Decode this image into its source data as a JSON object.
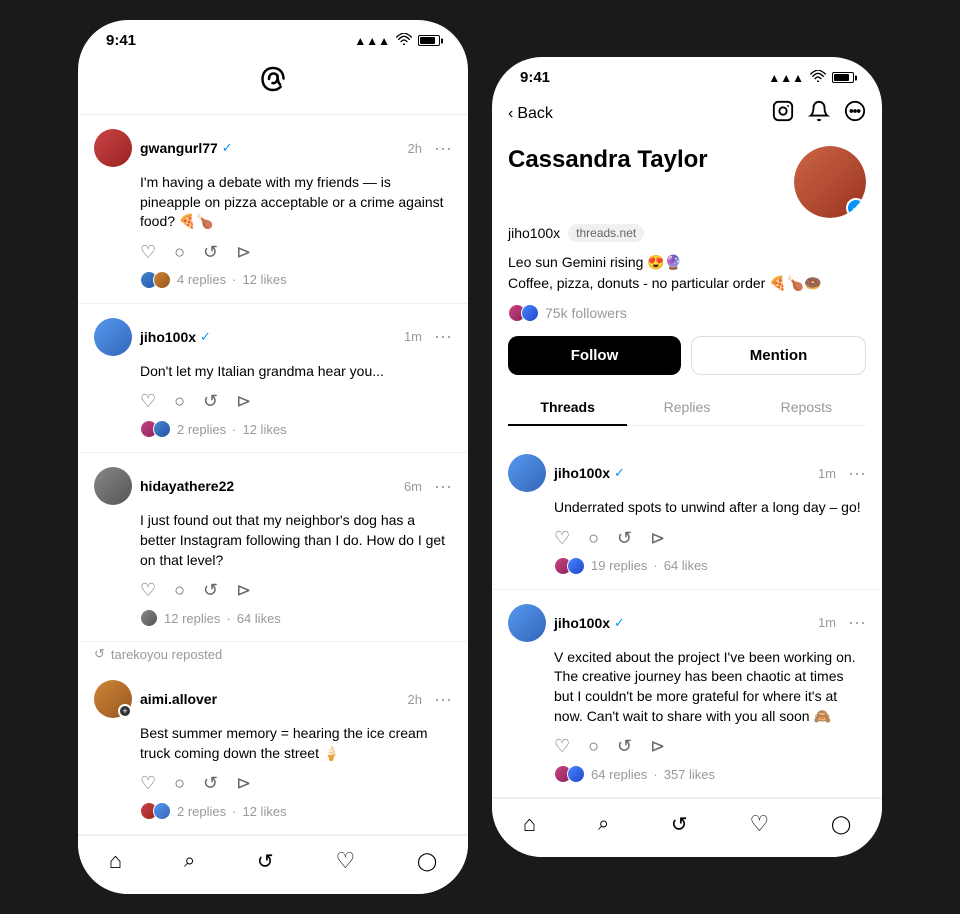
{
  "phone1": {
    "status": {
      "time": "9:41",
      "signal": "▲▲▲",
      "wifi": "wifi",
      "battery": "battery"
    },
    "logo": "⊕",
    "posts": [
      {
        "id": "post1",
        "username": "gwangurl77",
        "verified": true,
        "time": "2h",
        "avatar_color": "av1",
        "body": "I'm having a debate with my friends — is pineapple on pizza acceptable or a crime against food? 🍕🍗",
        "replies": "4 replies",
        "likes": "12 likes"
      },
      {
        "id": "post2",
        "username": "jiho100x",
        "verified": true,
        "time": "1m",
        "avatar_color": "av-jiho",
        "body": "Don't let my Italian grandma hear you...",
        "replies": "2 replies",
        "likes": "12 likes"
      },
      {
        "id": "post3",
        "username": "hidayathere22",
        "verified": false,
        "time": "6m",
        "avatar_color": "av3",
        "body": "I just found out that my neighbor's dog has a better Instagram following than I do. How do I get on that level?",
        "replies": "12 replies",
        "likes": "64 likes"
      }
    ],
    "repost": {
      "label": "tarekoyou reposted",
      "post": {
        "username": "aimi.allover",
        "verified": false,
        "time": "2h",
        "avatar_color": "av4",
        "body": "Best summer memory = hearing the ice cream truck coming down the street 🍦",
        "replies": "2 replies",
        "likes": "12 likes"
      }
    },
    "nav": {
      "home": "⌂",
      "search": "⌕",
      "compose": "↺",
      "heart": "♡",
      "profile": "◯"
    }
  },
  "phone2": {
    "status": {
      "time": "9:41"
    },
    "back_label": "Back",
    "profile": {
      "name": "Cassandra Taylor",
      "handle": "jiho100x",
      "domain": "threads.net",
      "bio_line1": "Leo sun Gemini rising 😍🔮",
      "bio_line2": "Coffee, pizza, donuts - no particular order 🍕🍗🍩",
      "followers": "75k followers",
      "avatar_color": "av-cassandra",
      "follow_btn": "Follow",
      "mention_btn": "Mention"
    },
    "tabs": [
      {
        "label": "Threads",
        "active": true
      },
      {
        "label": "Replies",
        "active": false
      },
      {
        "label": "Reposts",
        "active": false
      }
    ],
    "posts": [
      {
        "id": "ppost1",
        "username": "jiho100x",
        "verified": true,
        "time": "1m",
        "avatar_color": "av-jiho",
        "body": "Underrated spots to unwind after a long day – go!",
        "replies": "19 replies",
        "likes": "64 likes"
      },
      {
        "id": "ppost2",
        "username": "jiho100x",
        "verified": true,
        "time": "1m",
        "avatar_color": "av-jiho",
        "body": "V excited about the project I've been working on. The creative journey has been chaotic at times but I couldn't be more grateful for where it's at now. Can't wait to share with you all soon 🙈",
        "replies": "64 replies",
        "likes": "357 likes"
      }
    ],
    "nav": {
      "home": "⌂",
      "search": "⌕",
      "compose": "↺",
      "heart": "♡",
      "profile": "◯"
    }
  }
}
